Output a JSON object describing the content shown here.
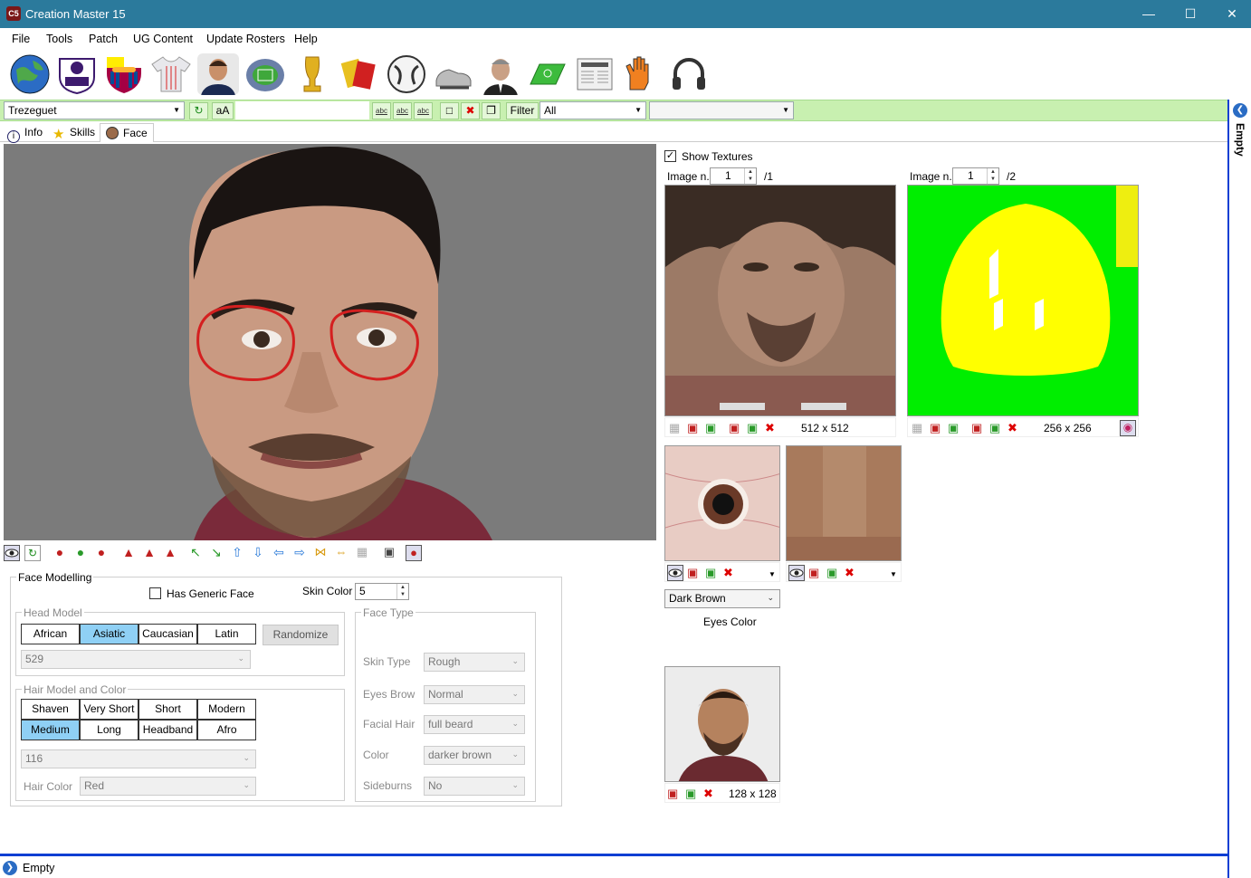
{
  "app": {
    "title": "Creation Master 15",
    "icon_label": "C5"
  },
  "menu": [
    "File",
    "Tools",
    "Patch",
    "UG Content",
    "Update Rosters",
    "Help"
  ],
  "toolbar_icons": [
    "globe-icon",
    "premier-league-icon",
    "fcb-crest-icon",
    "shirt-icon",
    "player-portrait-icon",
    "stadium-icon",
    "trophy-icon",
    "cards-icon",
    "ball-icon",
    "boots-icon",
    "manager-icon",
    "pitch-icon",
    "newspaper-icon",
    "gloves-icon",
    "headphones-icon"
  ],
  "editbar": {
    "player": "Trezeguet",
    "case_btn": "aA",
    "filter_label": "Filter",
    "filter_value": "All",
    "abc": "abc",
    "extra_value": ""
  },
  "tabs": [
    {
      "label": "Info"
    },
    {
      "label": "Skills"
    },
    {
      "label": "Face"
    }
  ],
  "face": {
    "group_label": "Face Modelling",
    "has_generic_face": "Has Generic Face",
    "skin_color_label": "Skin Color",
    "skin_color_value": "5",
    "head_model_label": "Head Model",
    "head_models": [
      "African",
      "Asiatic",
      "Caucasian",
      "Latin"
    ],
    "head_selected": "Asiatic",
    "randomize": "Randomize",
    "head_value": "529",
    "hair_group_label": "Hair Model and Color",
    "hair_models": [
      "Shaven",
      "Very Short",
      "Short",
      "Modern",
      "Medium",
      "Long",
      "Headband",
      "Afro"
    ],
    "hair_selected": "Medium",
    "hair_value": "116",
    "hair_color_label": "Hair Color",
    "hair_color_value": "Red",
    "face_type_label": "Face Type",
    "skin_type_label": "Skin Type",
    "skin_type_value": "Rough",
    "eyes_brow_label": "Eyes Brow",
    "eyes_brow_value": "Normal",
    "facial_hair_label": "Facial Hair",
    "facial_hair_value": "full beard",
    "color_label": "Color",
    "color_value": "darker brown",
    "sideburns_label": "Sideburns",
    "sideburns_value": "No"
  },
  "textures": {
    "show_textures": "Show Textures",
    "image1_label": "Image n.",
    "image1_value": "1",
    "image1_total": "/1",
    "image1_size": "512 x 512",
    "image2_label": "Image n.",
    "image2_value": "1",
    "image2_total": "/2",
    "image2_size": "256 x 256",
    "eyes_color_value": "Dark Brown",
    "eyes_color_label": "Eyes Color",
    "photo_size": "128 x 128"
  },
  "rightbar": {
    "label": "Empty"
  },
  "status": {
    "label": "Empty"
  },
  "colors": {
    "titlebar": "#2b7a9c",
    "editbar": "#c8f0b0",
    "selected": "#8fd0f5",
    "accent": "#0d3fd3"
  }
}
